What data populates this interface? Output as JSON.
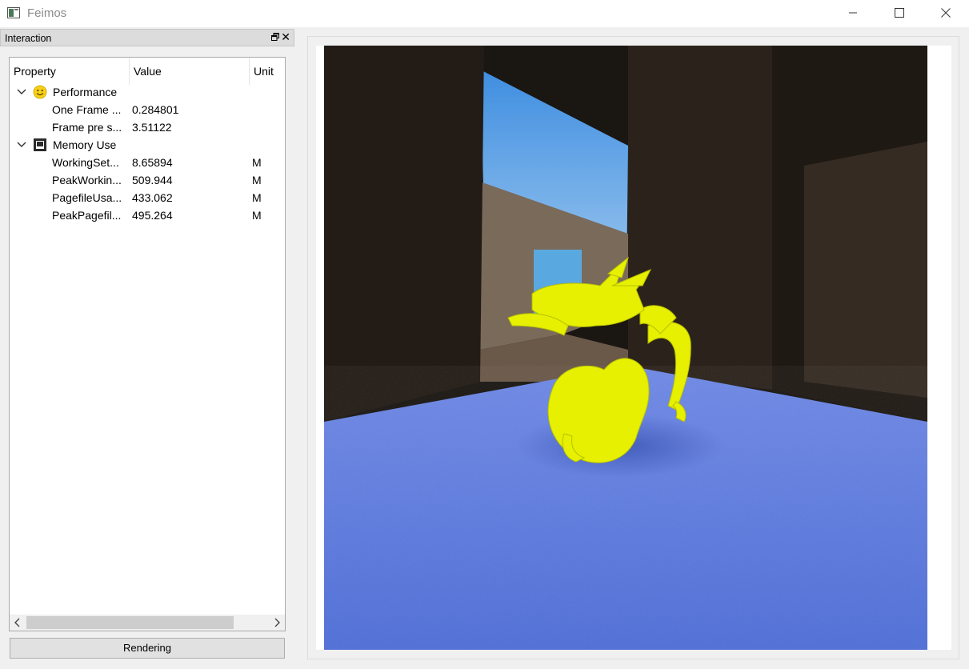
{
  "window": {
    "title": "Feimos",
    "minimize_icon": "minimize-icon",
    "maximize_icon": "maximize-icon",
    "close_icon": "close-icon"
  },
  "dock": {
    "title": "Interaction",
    "float_icon": "float-window-icon",
    "close_symbol": "✕"
  },
  "tree": {
    "columns": [
      "Property",
      "Value",
      "Unit"
    ],
    "groups": [
      {
        "label": "Performance",
        "icon": "smiley-icon",
        "expanded": true,
        "rows": [
          {
            "property": "One Frame ...",
            "value": "0.284801",
            "unit": ""
          },
          {
            "property": "Frame pre s...",
            "value": "3.51122",
            "unit": ""
          }
        ]
      },
      {
        "label": "Memory Use",
        "icon": "memory-icon",
        "expanded": true,
        "rows": [
          {
            "property": "WorkingSet...",
            "value": "8.65894",
            "unit": "M"
          },
          {
            "property": "PeakWorkin...",
            "value": "509.944",
            "unit": "M"
          },
          {
            "property": "PagefileUsa...",
            "value": "433.062",
            "unit": "M"
          },
          {
            "property": "PeakPagefil...",
            "value": "495.264",
            "unit": "M"
          }
        ]
      }
    ]
  },
  "buttons": {
    "rendering": "Rendering"
  },
  "render": {
    "subject": "yellow-dragon-on-blue-floor",
    "colors": {
      "dragon": "#e8f000",
      "floor": "#5a78dc",
      "sky": "#4aa0e8"
    }
  }
}
